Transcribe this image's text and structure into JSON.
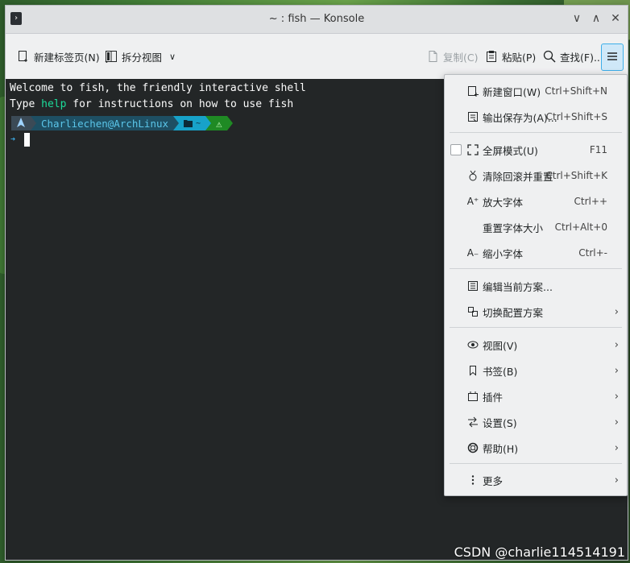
{
  "window": {
    "title": "~ : fish — Konsole",
    "app_icon_glyph": "›"
  },
  "window_controls": {
    "minimize": "∨",
    "maximize": "∧",
    "close": "✕"
  },
  "toolbar": {
    "new_tab": "新建标签页(N)",
    "split_view": "拆分视图",
    "copy": "复制(C)",
    "paste": "粘贴(P)",
    "find": "查找(F)..."
  },
  "terminal": {
    "welcome_line": "Welcome to fish, the friendly interactive shell",
    "help_prefix": "Type ",
    "help_word": "help",
    "help_suffix": " for instructions on how to use fish",
    "prompt": {
      "user_host": "Charliechen@ArchLinux",
      "dir": "~",
      "status": "⚠"
    },
    "input_prompt_glyph": "➜"
  },
  "menu": {
    "items": [
      {
        "label": "新建窗口(W)",
        "shortcut": "Ctrl+Shift+N"
      },
      {
        "label": "输出保存为(A)...",
        "shortcut": "Ctrl+Shift+S"
      },
      {
        "label": "全屏模式(U)",
        "shortcut": "F11"
      },
      {
        "label": "清除回滚并重置",
        "shortcut": "Ctrl+Shift+K"
      },
      {
        "label": "放大字体",
        "shortcut": "Ctrl++"
      },
      {
        "label": "重置字体大小",
        "shortcut": "Ctrl+Alt+0"
      },
      {
        "label": "缩小字体",
        "shortcut": "Ctrl+-"
      },
      {
        "label": "编辑当前方案..."
      },
      {
        "label": "切换配置方案"
      },
      {
        "label": "视图(V)"
      },
      {
        "label": "书签(B)"
      },
      {
        "label": "插件"
      },
      {
        "label": "设置(S)"
      },
      {
        "label": "帮助(H)"
      },
      {
        "label": "更多"
      }
    ],
    "submenu_glyph": "›"
  },
  "watermark": "CSDN @charlie114514191",
  "colors": {
    "terminal_bg": "#232627",
    "accent": "#3daee9",
    "help_green": "#1cdc9a"
  }
}
